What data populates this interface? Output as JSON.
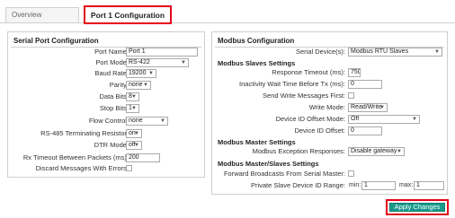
{
  "tabs": {
    "overview": "Overview",
    "port1": "Port 1 Configuration"
  },
  "serial": {
    "title": "Serial Port Configuration",
    "port_name_label": "Port Name:",
    "port_name": "Port 1",
    "port_mode_label": "Port Mode:",
    "port_mode": "RS-422",
    "baud_rate_label": "Baud Rate:",
    "baud_rate": "19200",
    "parity_label": "Parity:",
    "parity": "none",
    "data_bits_label": "Data Bits:",
    "data_bits": "8",
    "stop_bits_label": "Stop Bits:",
    "stop_bits": "1",
    "flow_control_label": "Flow Control:",
    "flow_control": "none",
    "rs485_label": "RS-485 Terminating Resistor:",
    "rs485": "on",
    "dtr_mode_label": "DTR Mode:",
    "dtr_mode": "off",
    "rx_timeout_label": "Rx Timeout Between Packets (ms):",
    "rx_timeout": "200",
    "discard_label": "Discard Messages With Errors:"
  },
  "modbus": {
    "title": "Modbus Configuration",
    "serial_devices_label": "Serial Device(s):",
    "serial_devices": "Modbus RTU Slaves",
    "slaves_heading": "Modbus Slaves Settings",
    "response_timeout_label": "Response Timeout (ms):",
    "response_timeout": "750",
    "inactivity_label": "Inactivity Wait Time Before Tx (ms):",
    "inactivity": "0",
    "send_write_label": "Send Write Messages First:",
    "write_mode_label": "Write Mode:",
    "write_mode": "Read/Write",
    "device_id_mode_label": "Device ID Offset Mode:",
    "device_id_mode": "Off",
    "device_id_offset_label": "Device ID Offset:",
    "device_id_offset": "0",
    "master_heading": "Modbus Master Settings",
    "exception_label": "Modbus Exception Responses:",
    "exception": "Disable gateway",
    "master_slaves_heading": "Modbus Master/Slaves Settings",
    "forward_label": "Forward Broadcasts From Serial Master:",
    "private_label": "Private Slave Device ID Range:",
    "min_label": "min:",
    "min_value": "1",
    "max_label": "max:",
    "max_value": "1"
  },
  "apply_label": "Apply Changes"
}
